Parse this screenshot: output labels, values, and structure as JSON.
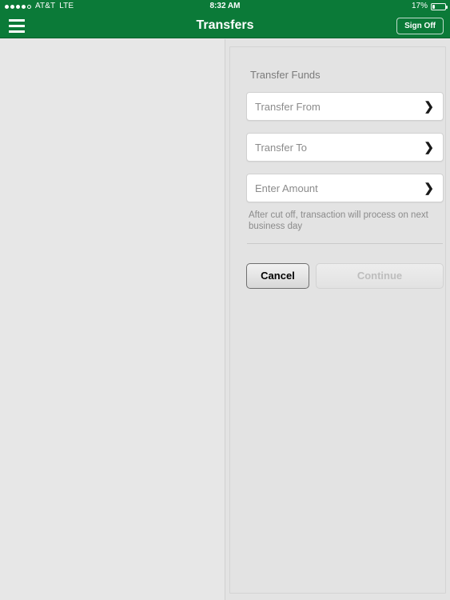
{
  "status_bar": {
    "carrier": "AT&T",
    "network": "LTE",
    "signal_filled_dots": 4,
    "signal_total_dots": 5,
    "time": "8:32 AM",
    "battery_percent": "17%",
    "battery_level": 17
  },
  "nav_bar": {
    "title": "Transfers",
    "menu_icon": "hamburger-menu-icon",
    "sign_off_label": "Sign Off"
  },
  "form": {
    "section_title": "Transfer Funds",
    "fields": [
      {
        "label": "Transfer From",
        "value": "",
        "chevron": "❯"
      },
      {
        "label": "Transfer To",
        "value": "",
        "chevron": "❯"
      },
      {
        "label": "Enter Amount",
        "value": "",
        "chevron": "❯"
      }
    ],
    "helper_text": "After cut off, transaction will process on next business day",
    "buttons": {
      "cancel_label": "Cancel",
      "continue_label": "Continue",
      "continue_enabled": false
    }
  },
  "colors": {
    "brand_green": "#0b7a38",
    "page_background": "#e7e7e7",
    "panel_background": "#e3e3e3",
    "field_background": "#ffffff",
    "muted_text": "#8b8b8b"
  }
}
